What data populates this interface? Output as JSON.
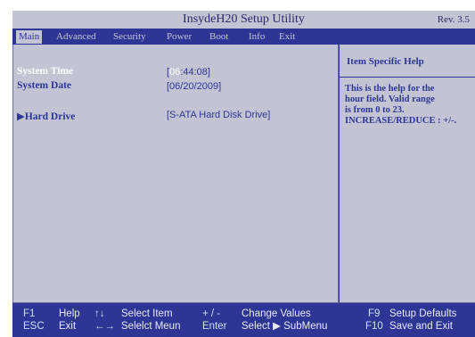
{
  "window": {
    "title": "InsydeH20 Setup Utility",
    "revision": "Rev. 3.5"
  },
  "menu": {
    "tabs": [
      {
        "label": "Main",
        "active": true
      },
      {
        "label": "Advanced",
        "active": false
      },
      {
        "label": "Security",
        "active": false
      },
      {
        "label": "Power",
        "active": false
      },
      {
        "label": "Boot",
        "active": false
      },
      {
        "label": "Info",
        "active": false
      },
      {
        "label": "Exit",
        "active": false
      }
    ]
  },
  "main": {
    "system_time": {
      "label": "System Time",
      "open": "[",
      "hour": "06",
      "rest": ":44:08]"
    },
    "system_date": {
      "label": "System Date",
      "value": "[06/20/2009]"
    },
    "hard_drive": {
      "label": "▶Hard Drive",
      "value": "[S-ATA Hard Disk Drive]"
    }
  },
  "help": {
    "title": "Item Specific Help",
    "text_lines": [
      "This is the help for the",
      "hour field. Valid range",
      "is from 0 to 23.",
      "INCREASE/REDUCE : +/-."
    ]
  },
  "keys": {
    "row1": [
      {
        "key": "F1",
        "desc": "Help"
      },
      {
        "key": "↑↓",
        "desc": "Select Item"
      },
      {
        "key": "+ / -",
        "desc": "Change Values"
      },
      {
        "key": "F9",
        "desc": "Setup Defaults"
      }
    ],
    "row2": [
      {
        "key": "ESC",
        "desc": "Exit"
      },
      {
        "key": "←→",
        "desc": "Selelct Meun"
      },
      {
        "key": "Enter",
        "desc": "Select ▶ SubMenu"
      },
      {
        "key": "F10",
        "desc": "Save and Exit"
      }
    ]
  },
  "colors": {
    "panel": "#c3c4d3",
    "navy": "#2d3595",
    "highlight_text": "#ffffff"
  }
}
